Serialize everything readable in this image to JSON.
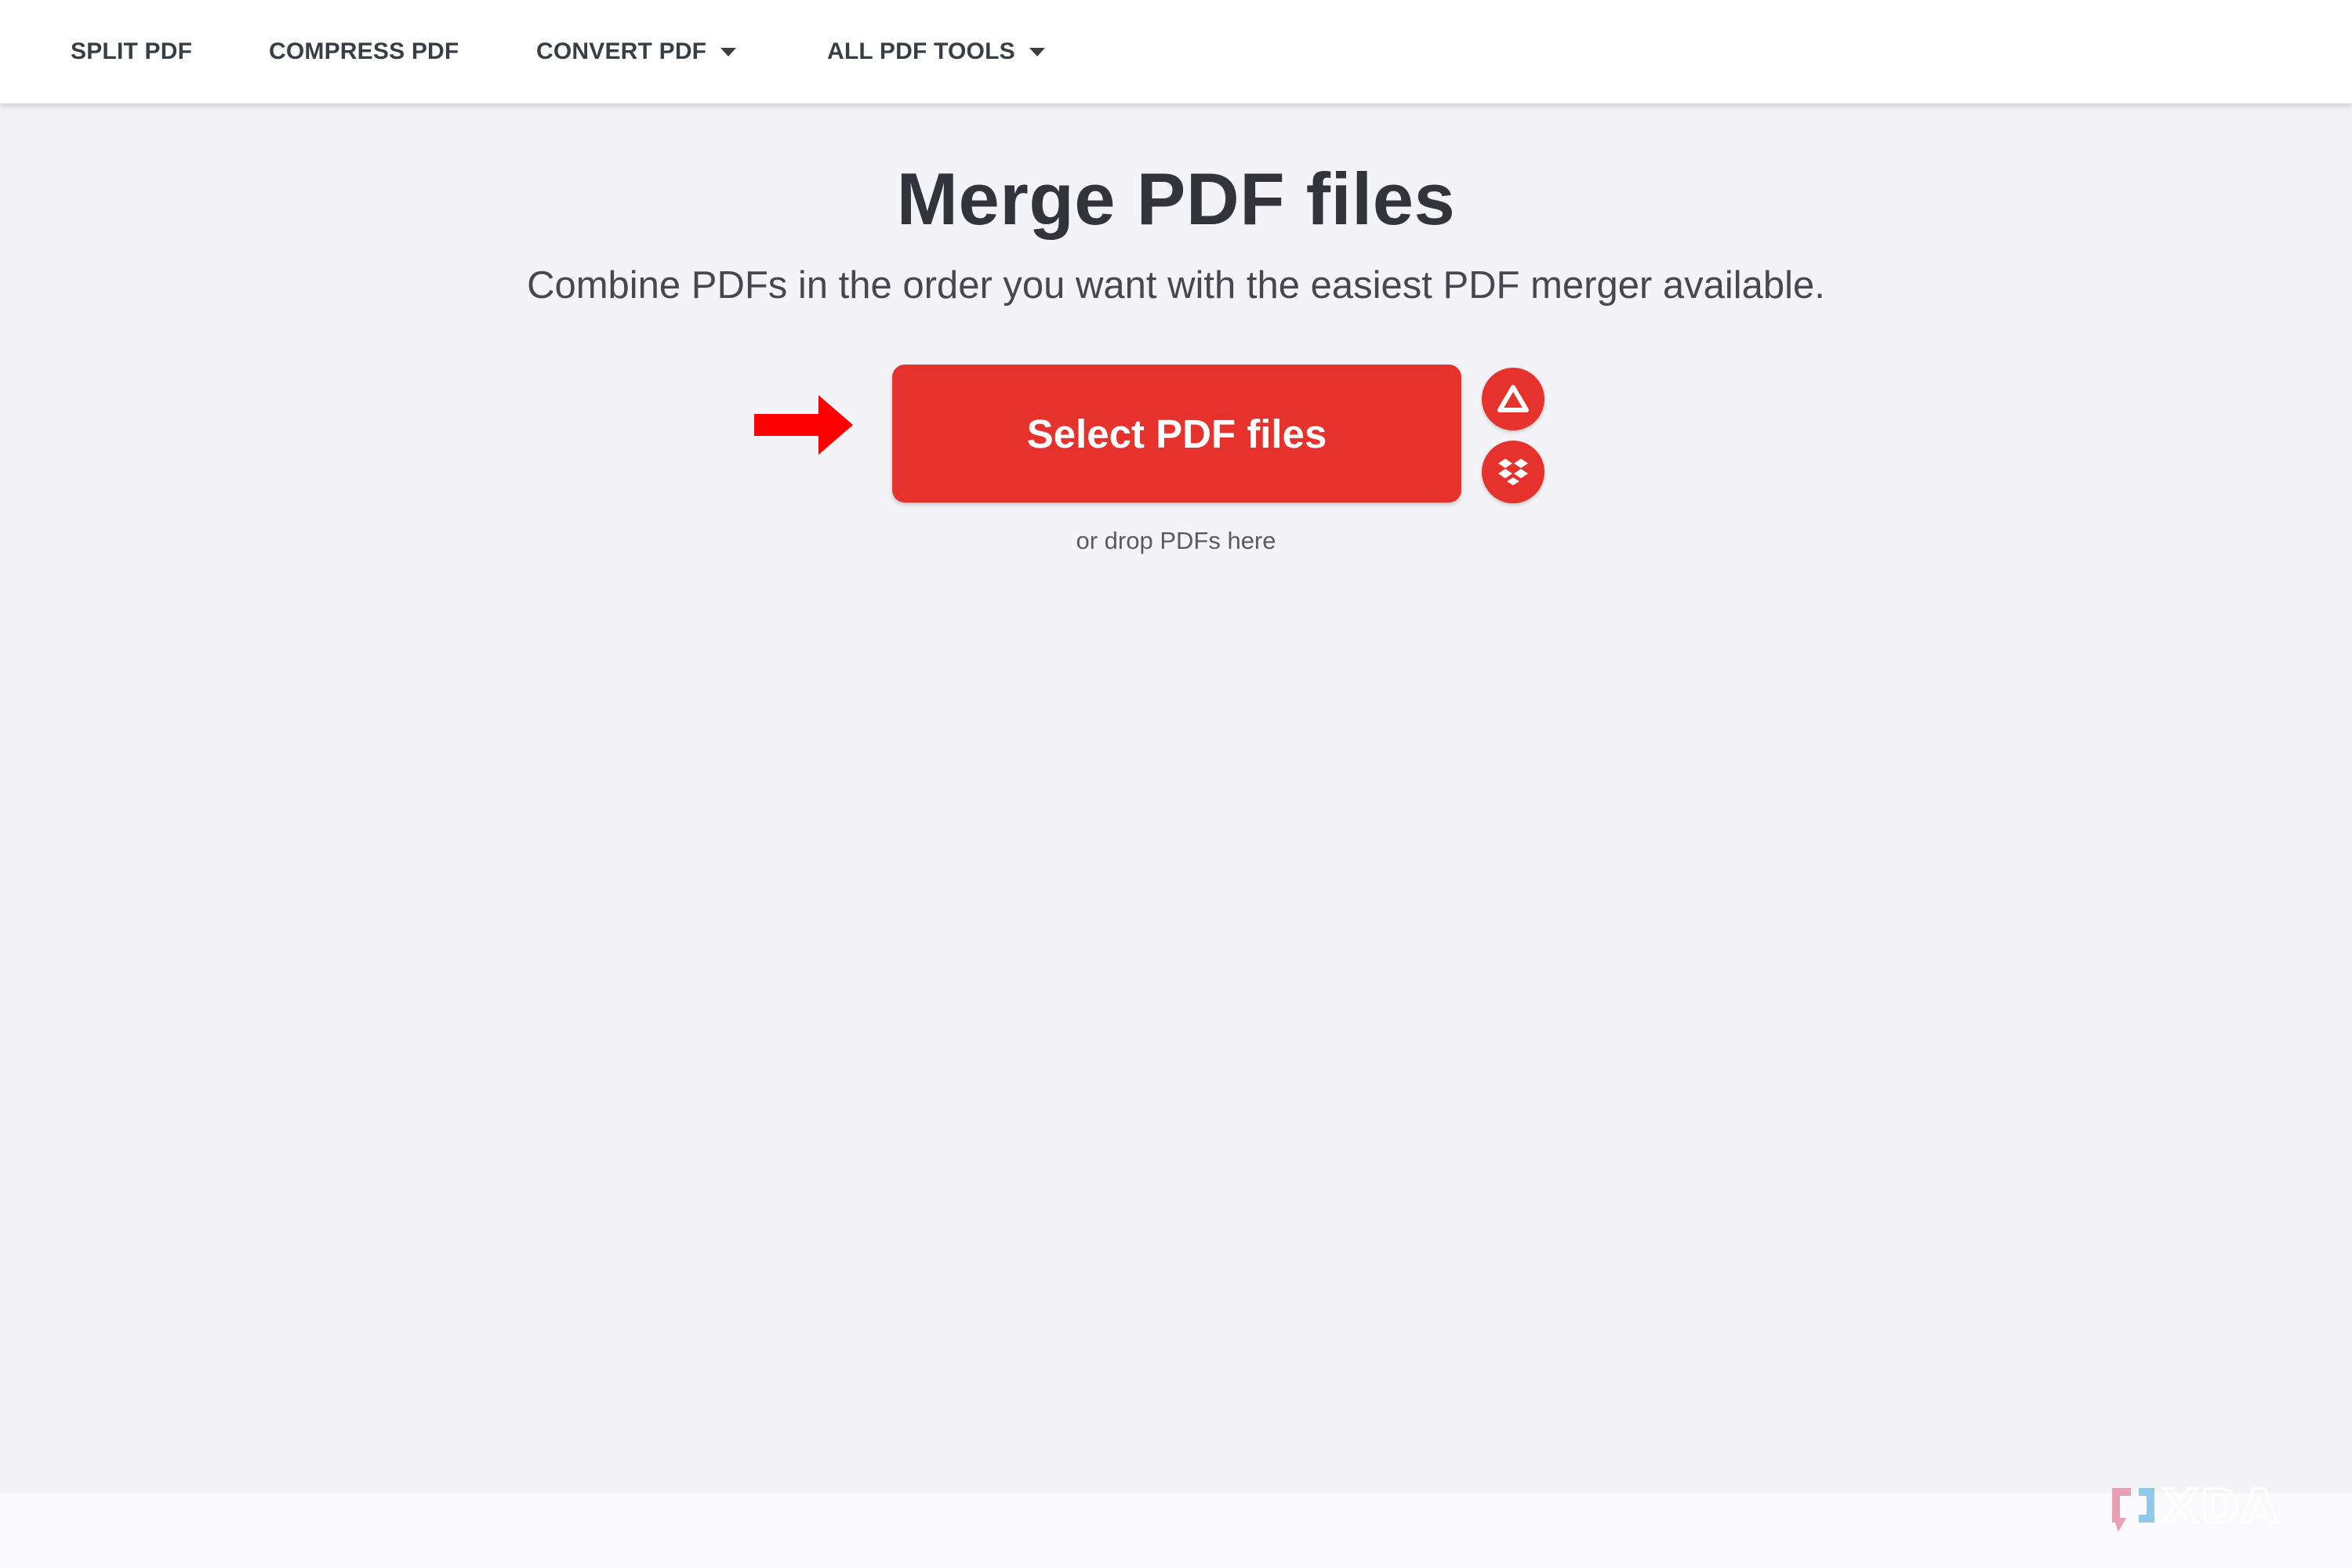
{
  "nav": {
    "items": [
      {
        "label": "SPLIT PDF"
      },
      {
        "label": "COMPRESS PDF"
      },
      {
        "label": "CONVERT PDF",
        "has_dropdown": true
      },
      {
        "label": "ALL PDF TOOLS",
        "has_dropdown": true
      }
    ]
  },
  "main": {
    "title": "Merge PDF files",
    "subtitle": "Combine PDFs in the order you want with the easiest PDF merger available.",
    "select_button_label": "Select PDF files",
    "drop_hint": "or drop PDFs here",
    "cloud_options": [
      {
        "icon": "google-drive-icon"
      },
      {
        "icon": "dropbox-icon"
      }
    ]
  },
  "annotation": {
    "arrow_icon": "red-arrow-icon",
    "arrow_color": "#ff0000"
  },
  "watermark": {
    "text": "XDA"
  },
  "colors": {
    "accent": "#e5322d",
    "nav_text": "#383e45",
    "title_text": "#33333b",
    "page_background": "#f4f4f8"
  }
}
